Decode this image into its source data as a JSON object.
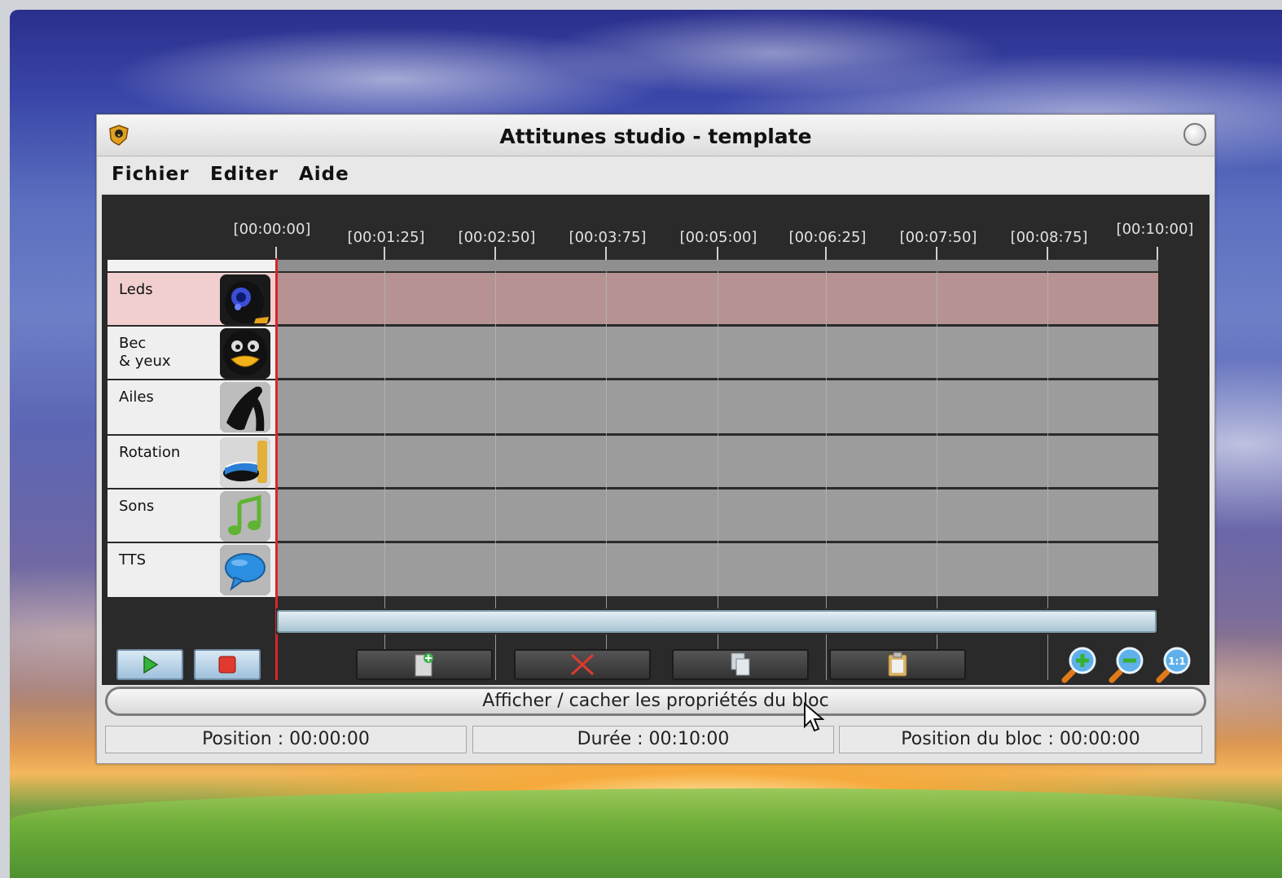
{
  "window": {
    "title": "Attitunes studio - template",
    "app_icon": "tux-shield-icon",
    "close_icon": "close-circle-icon"
  },
  "menu": [
    "Fichier",
    "Editer",
    "Aide"
  ],
  "timeline": {
    "ruler": [
      "[00:00:00]",
      "[00:01:25]",
      "[00:02:50]",
      "[00:03:75]",
      "[00:05:00]",
      "[00:06:25]",
      "[00:07:50]",
      "[00:08:75]",
      "[00:10:00]"
    ],
    "playhead_position": "00:00:00",
    "tracks": [
      {
        "label": "Leds",
        "icon": "tux-leds-icon",
        "active": true
      },
      {
        "label": "Bec\n& yeux",
        "icon": "tux-beak-eyes-icon",
        "active": false
      },
      {
        "label": "Ailes",
        "icon": "tux-wings-icon",
        "active": false
      },
      {
        "label": "Rotation",
        "icon": "rotation-icon",
        "active": false
      },
      {
        "label": "Sons",
        "icon": "music-note-icon",
        "active": false
      },
      {
        "label": "TTS",
        "icon": "speech-bubble-icon",
        "active": false
      }
    ]
  },
  "toolbar": {
    "play": "play-icon",
    "stop": "stop-icon",
    "new_block": "new-block-icon",
    "delete_block": "delete-x-icon",
    "copy": "copy-icon",
    "paste": "paste-icon",
    "zoom_in": "zoom-in-icon",
    "zoom_out": "zoom-out-icon",
    "zoom_reset": "zoom-reset-icon",
    "zoom_reset_label": "1:1"
  },
  "properties_toggle": "Afficher / cacher les propriétés du bloc",
  "status": {
    "position": "Position : 00:00:00",
    "duration": "Durée : 00:10:00",
    "block_position": "Position du bloc : 00:00:00"
  },
  "colors": {
    "active_track": "#f2cfcf",
    "active_lane": "#b69392",
    "lane": "#9c9c9c",
    "playhead": "#d7262a",
    "panel": "#2a2a2a"
  }
}
